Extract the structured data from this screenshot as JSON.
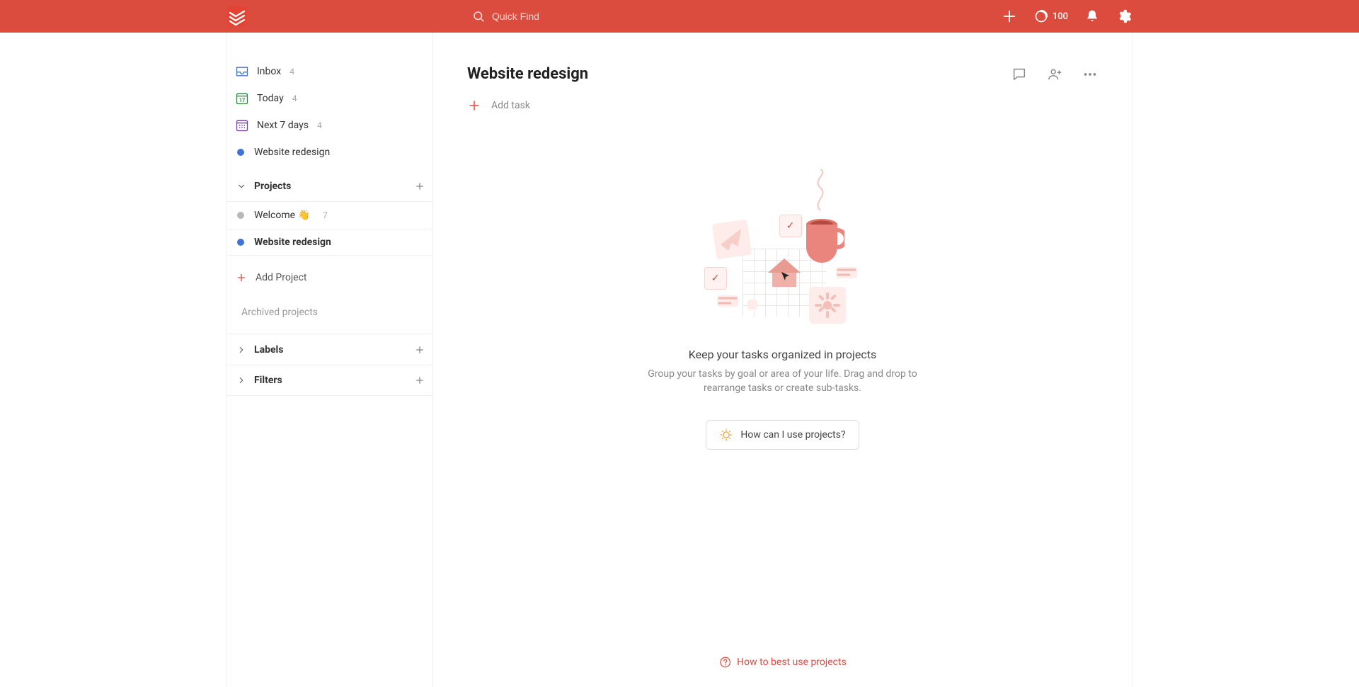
{
  "topbar": {
    "search_placeholder": "Quick Find",
    "karma_points": "100"
  },
  "sidebar": {
    "inbox": {
      "label": "Inbox",
      "count": "4"
    },
    "today": {
      "label": "Today",
      "count": "4",
      "date": "17"
    },
    "next7": {
      "label": "Next 7 days",
      "count": "4"
    },
    "favorites": [
      {
        "label": "Website redesign",
        "color": "#4073d6"
      }
    ],
    "projects_header": "Projects",
    "projects": [
      {
        "label": "Welcome 👋",
        "color": "#b8b8b8",
        "count": "7",
        "active": false
      },
      {
        "label": "Website redesign",
        "color": "#4073d6",
        "count": "",
        "active": true
      }
    ],
    "add_project_label": "Add Project",
    "archived_label": "Archived projects",
    "labels_header": "Labels",
    "filters_header": "Filters"
  },
  "main": {
    "project_title": "Website redesign",
    "add_task_label": "Add task",
    "empty_title": "Keep your tasks organized in projects",
    "empty_desc": "Group your tasks by goal or area of your life. Drag and drop to rearrange tasks or create sub-tasks.",
    "help_button": "How can I use projects?",
    "footer_link": "How to best use projects"
  }
}
